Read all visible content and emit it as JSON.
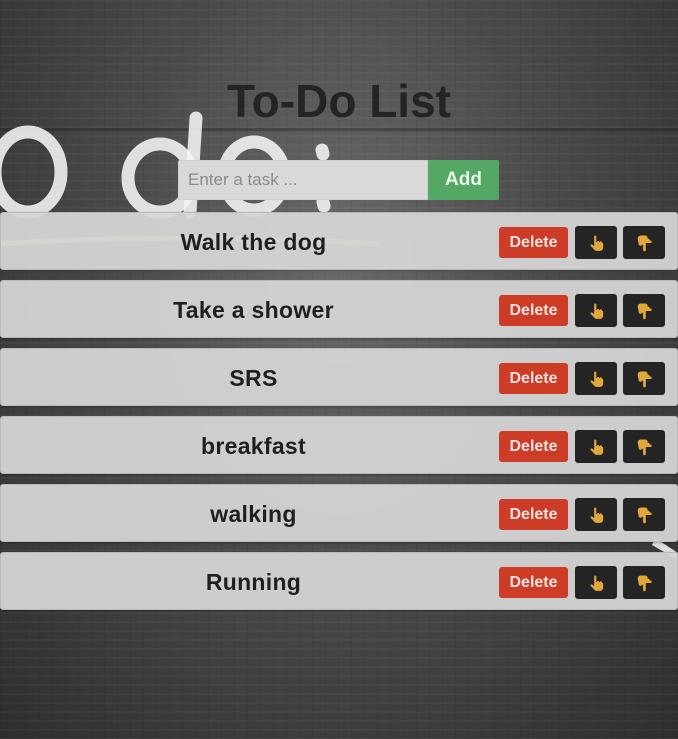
{
  "header": {
    "title": "To-Do List"
  },
  "add_form": {
    "placeholder": "Enter a task ...",
    "value": "",
    "add_label": "Add"
  },
  "tasks": [
    {
      "text": "Walk the dog"
    },
    {
      "text": "Take a shower"
    },
    {
      "text": "SRS"
    },
    {
      "text": "breakfast"
    },
    {
      "text": "walking"
    },
    {
      "text": "Running"
    }
  ],
  "row_actions": {
    "delete_label": "Delete",
    "up_icon": "hand-pointing-up-icon",
    "down_icon": "hand-pointing-down-icon"
  },
  "colors": {
    "add": "#55a765",
    "delete": "#cd3c26",
    "move": "#242424",
    "hand": "#e3a83b"
  }
}
